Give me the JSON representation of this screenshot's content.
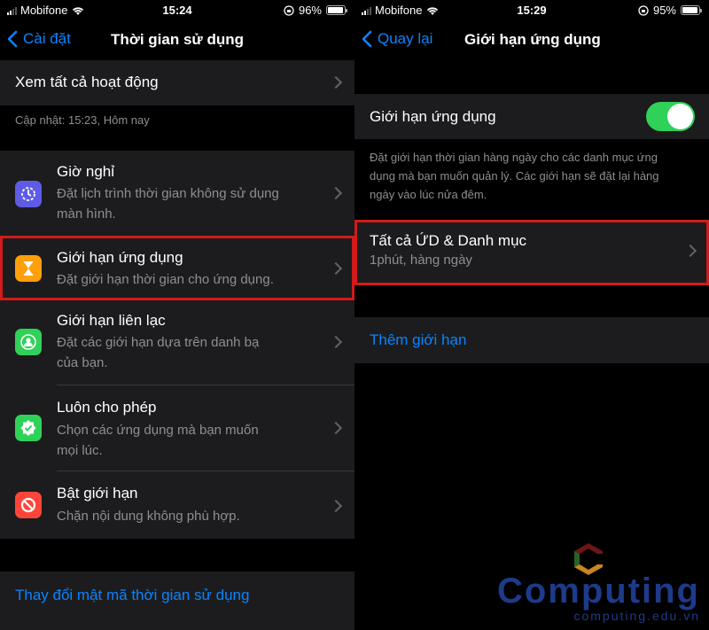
{
  "left": {
    "status": {
      "carrier": "Mobifone",
      "time": "15:24",
      "battery": "96%",
      "battery_level": 0.96
    },
    "nav": {
      "back_label": "Cài đặt",
      "title": "Thời gian sử dụng"
    },
    "see_all": "Xem tất cả hoạt động",
    "updated": "Cập nhật: 15:23, Hôm nay",
    "items": [
      {
        "title": "Giờ nghỉ",
        "subtitle_lines": [
          "Đặt lịch trình thời gian không sử dụng",
          "màn hình."
        ],
        "icon": "downtime-icon",
        "color": "#5e5ce6"
      },
      {
        "title": "Giới hạn ứng dụng",
        "subtitle_lines": [
          "Đặt giới hạn thời gian cho ứng dụng."
        ],
        "icon": "hourglass-icon",
        "color": "#ff9f0a"
      },
      {
        "title": "Giới hạn liên lạc",
        "subtitle_lines": [
          "Đặt các giới hạn dựa trên danh bạ",
          "của bạn."
        ],
        "icon": "contact-icon",
        "color": "#30d158"
      },
      {
        "title": "Luôn cho phép",
        "subtitle_lines": [
          "Chọn các ứng dụng mà bạn muốn",
          "mọi lúc."
        ],
        "icon": "checkmark-badge-icon",
        "color": "#30d158"
      },
      {
        "title": "Bật giới hạn",
        "subtitle_lines": [
          "Chặn nội dung không phù hợp."
        ],
        "icon": "restriction-icon",
        "color": "#ff453a"
      }
    ],
    "change_passcode": "Thay đổi mật mã thời gian sử dụng"
  },
  "right": {
    "status": {
      "carrier": "Mobifone",
      "time": "15:29",
      "battery": "95%",
      "battery_level": 0.95
    },
    "nav": {
      "back_label": "Quay lại",
      "title": "Giới hạn ứng dụng"
    },
    "toggle_label": "Giới hạn ứng dụng",
    "toggle_on": true,
    "description_lines": [
      "Đặt giới hạn thời gian hàng ngày cho các danh mục ứng",
      "dụng mà bạn muốn quản lý. Các giới hạn sẽ đặt lại hàng",
      "ngày vào lúc nửa đêm."
    ],
    "limit_item": {
      "title": "Tất cả ỨD & Danh mục",
      "subtitle": "1phút, hàng ngày"
    },
    "add_limit": "Thêm giới hạn"
  },
  "watermark": {
    "name": "Computing",
    "url": "computing.edu.vn",
    "color": "#1e3a8a"
  },
  "colors": {
    "accent": "#0a84ff",
    "highlight": "#d21a1a",
    "toggle_on": "#30d158"
  }
}
